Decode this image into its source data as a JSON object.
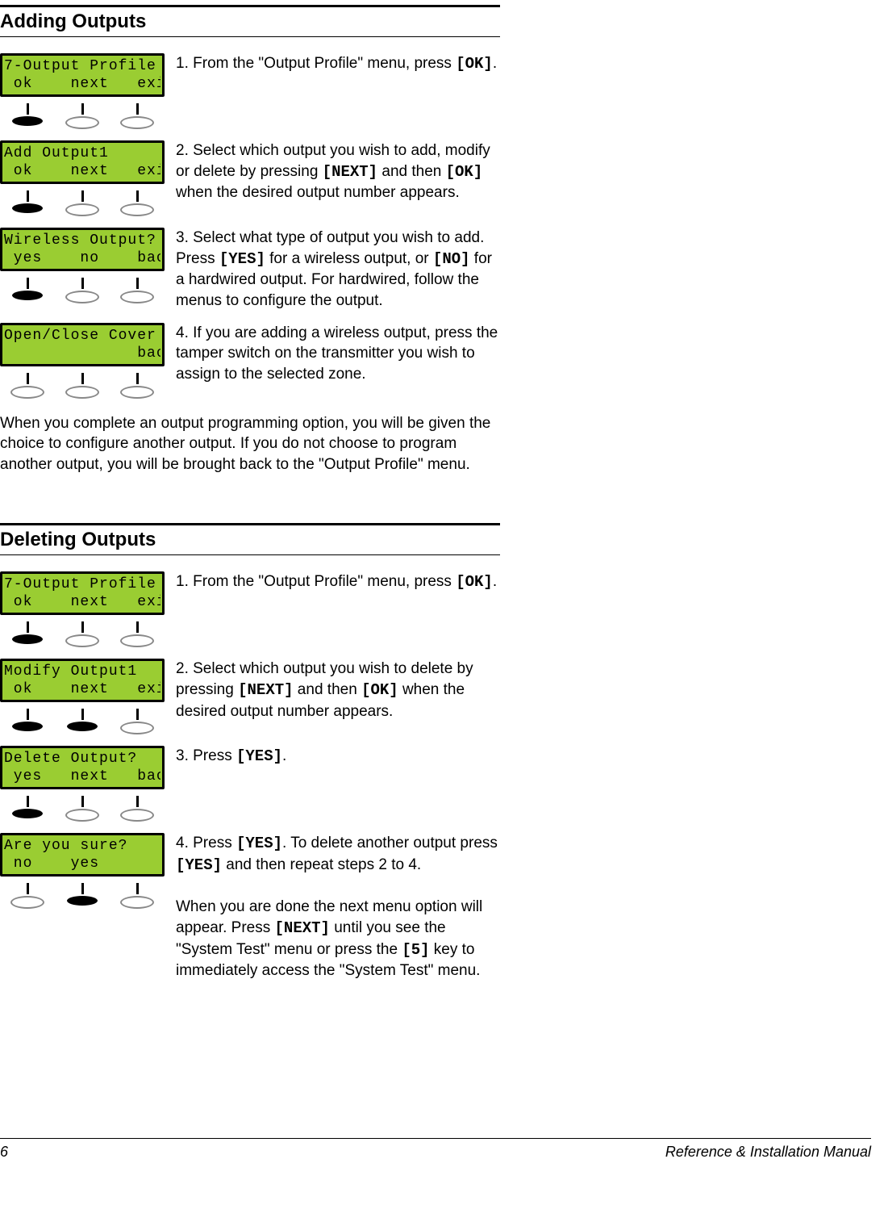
{
  "sections": {
    "adding": {
      "heading": "Adding Outputs",
      "steps": [
        {
          "lcd": {
            "line1": "7-Output Profile",
            "line2": " ok    next   exit"
          },
          "buttons": [
            "filled",
            "hollow",
            "hollow"
          ],
          "num": "1.",
          "text_before": " From the \"Output Profile\" menu, press ",
          "key1": "[OK]",
          "text_after": "."
        },
        {
          "lcd": {
            "line1": "Add Output1",
            "line2": " ok    next   exit"
          },
          "buttons": [
            "filled",
            "hollow",
            "hollow"
          ],
          "num": "2.",
          "text_before": " Select which output you wish to add, modify or delete by pressing ",
          "key1": "[NEXT]",
          "text_mid": " and then ",
          "key2": "[OK]",
          "text_after": " when the desired output number appears."
        },
        {
          "lcd": {
            "line1": "Wireless Output?",
            "line2": " yes    no    back"
          },
          "buttons": [
            "filled",
            "hollow",
            "hollow"
          ],
          "num": "3.",
          "text_before": " Select what type of output you wish to add. Press ",
          "key1": "[YES]",
          "text_mid": " for a wireless output, or ",
          "key2": "[NO]",
          "text_after": " for a hardwired output. For hardwired, follow the menus to configure the output."
        },
        {
          "lcd": {
            "line1": "Open/Close Cover",
            "line2": "              back"
          },
          "buttons": [
            "hollow",
            "hollow",
            "hollow"
          ],
          "num": "4.",
          "text_before": " If you are adding a wireless output, press the tamper switch on the transmitter you wish to assign to the selected zone.",
          "key1": "",
          "text_after": ""
        }
      ],
      "closing": "When you complete an output programming option, you will be given the choice to configure another output. If you do not choose to program another output, you will be brought back to the \"Output Profile\" menu."
    },
    "deleting": {
      "heading": "Deleting Outputs",
      "steps": [
        {
          "lcd": {
            "line1": "7-Output Profile",
            "line2": " ok    next   exit"
          },
          "buttons": [
            "filled",
            "hollow",
            "hollow"
          ],
          "num": "1.",
          "text_before": " From the \"Output Profile\" menu, press ",
          "key1": "[OK]",
          "text_after": "."
        },
        {
          "lcd": {
            "line1": "Modify Output1",
            "line2": " ok    next   exit"
          },
          "buttons": [
            "filled",
            "filled",
            "hollow"
          ],
          "num": "2.",
          "text_before": " Select which output you wish to delete by pressing ",
          "key1": "[NEXT]",
          "text_mid": " and then ",
          "key2": "[OK]",
          "text_after": " when the desired output number appears."
        },
        {
          "lcd": {
            "line1": "Delete Output?",
            "line2": " yes   next   back"
          },
          "buttons": [
            "filled",
            "hollow",
            "hollow"
          ],
          "num": "3.",
          "text_before": " Press ",
          "key1": "[YES]",
          "text_after": "."
        },
        {
          "lcd": {
            "line1": "Are you sure?",
            "line2": " no    yes"
          },
          "buttons": [
            "hollow",
            "filled",
            "hollow"
          ],
          "num": "4.",
          "text_before": " Press ",
          "key1": "[YES]",
          "text_mid": ". To delete another output press ",
          "key2": "[YES]",
          "text_after": " and then repeat steps 2 to 4."
        }
      ],
      "closing_part1": "When you are done the next menu option will appear. Press ",
      "closing_key1": "[NEXT]",
      "closing_part2": " until you see the \"System Test\" menu or press the ",
      "closing_key2": "[5]",
      "closing_part3": " key to immediately access the \"System Test\" menu."
    }
  },
  "footer": {
    "page": "6",
    "doc": "Reference & Installation Manual"
  }
}
